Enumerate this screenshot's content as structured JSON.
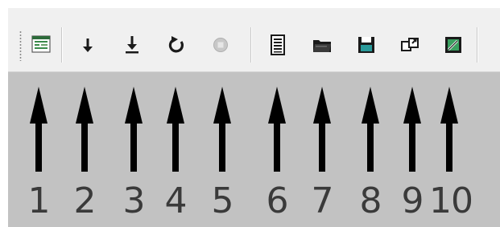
{
  "toolbar": {
    "buttons": [
      {
        "id": 1,
        "icon": "cluster-window-icon"
      },
      {
        "id": 2,
        "icon": "arrow-down-icon"
      },
      {
        "id": 3,
        "icon": "download-to-bottom-icon"
      },
      {
        "id": 4,
        "icon": "refresh-icon"
      },
      {
        "id": 5,
        "icon": "stop-icon",
        "disabled": true
      },
      {
        "id": 6,
        "icon": "document-list-icon"
      },
      {
        "id": 7,
        "icon": "open-folder-icon"
      },
      {
        "id": 8,
        "icon": "save-disk-icon"
      },
      {
        "id": 9,
        "icon": "export-icon"
      },
      {
        "id": 10,
        "icon": "edit-save-icon"
      }
    ]
  },
  "annotations": {
    "labels": [
      "1",
      "2",
      "3",
      "4",
      "5",
      "6",
      "7",
      "8",
      "9",
      "10"
    ]
  },
  "colors": {
    "toolbar_bg": "#f0f0f0",
    "panel_bg": "#c2c2c2",
    "arrow": "#000000",
    "label_text": "#3a3a3a"
  }
}
